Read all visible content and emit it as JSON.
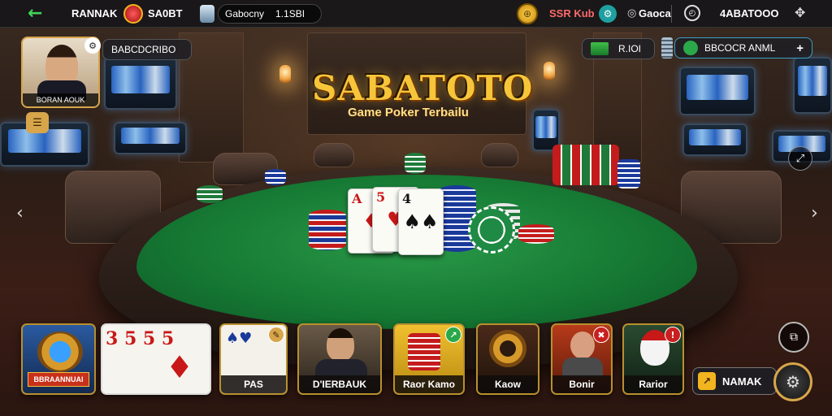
{
  "topbar": {
    "back_icon": "back-arrow-icon",
    "username": "RANNAK",
    "coin_label": "SA0BT",
    "gem_label": "Gabocny",
    "balance": "1.1SBI",
    "promo_label": "SSR Kub",
    "menu_label": "Gaoca",
    "account_id": "4ABATOOO",
    "colors": {
      "accent": "#f2b51f",
      "bar": "#141418"
    }
  },
  "hero": {
    "title": "SABATOTO",
    "subtitle": "Game Poker Terbailu"
  },
  "left_panel": {
    "avatar_caption": "BORAN AOUK",
    "room_label": "BABCDCRIBO"
  },
  "right_panel": {
    "gift_label": "R.IOI",
    "wallet_label": "BBCOCR ANML"
  },
  "bottom": {
    "tiles": [
      {
        "label": "BBRAANNUAI",
        "icon": "trophy-badge-icon"
      },
      {
        "label": "",
        "icon": "playing-cards-icon"
      },
      {
        "label": "PAS",
        "icon": "card-fan-icon"
      },
      {
        "label": "D'IERBAUK",
        "icon": "dealer-avatar-icon"
      },
      {
        "label": "Raor Kamo",
        "icon": "chip-stack-icon"
      },
      {
        "label": "Kaow",
        "icon": "roulette-icon"
      },
      {
        "label": "Bonir",
        "icon": "monk-avatar-icon"
      },
      {
        "label": "Rarior",
        "icon": "mask-avatar-icon"
      }
    ],
    "action_label": "NAMAK"
  }
}
